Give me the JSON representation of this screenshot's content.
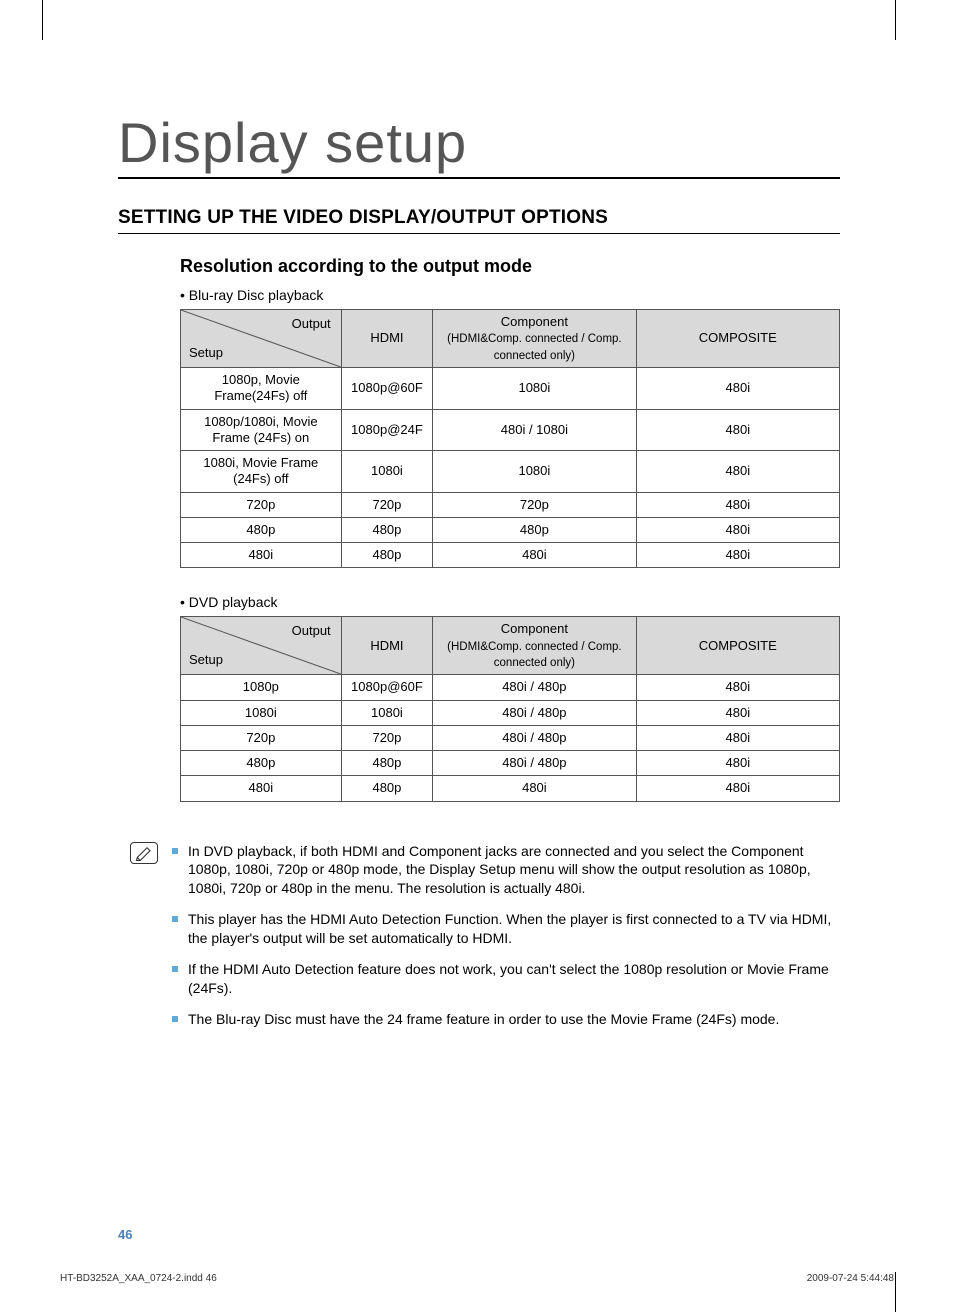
{
  "chapter_title": "Display setup",
  "section_title": "SETTING UP THE VIDEO DISPLAY/OUTPUT OPTIONS",
  "sub_title": "Resolution according to the output mode",
  "table1_caption": "Blu-ray Disc playback",
  "table2_caption": "DVD playback",
  "hdr_output": "Output",
  "hdr_setup": "Setup",
  "col_hdmi": "HDMI",
  "col_component_l1": "Component",
  "col_component_l2": "(HDMI&Comp. connected / Comp. connected only)",
  "col_composite": "COMPOSITE",
  "t1": {
    "rows": [
      {
        "setup": "1080p, Movie Frame(24Fs) off",
        "hdmi": "1080p@60F",
        "comp": "1080i",
        "compos": "480i"
      },
      {
        "setup": "1080p/1080i, Movie Frame (24Fs) on",
        "hdmi": "1080p@24F",
        "comp": "480i / 1080i",
        "compos": "480i"
      },
      {
        "setup": "1080i, Movie Frame (24Fs) off",
        "hdmi": "1080i",
        "comp": "1080i",
        "compos": "480i"
      },
      {
        "setup": "720p",
        "hdmi": "720p",
        "comp": "720p",
        "compos": "480i"
      },
      {
        "setup": "480p",
        "hdmi": "480p",
        "comp": "480p",
        "compos": "480i"
      },
      {
        "setup": "480i",
        "hdmi": "480p",
        "comp": "480i",
        "compos": "480i"
      }
    ]
  },
  "t2": {
    "rows": [
      {
        "setup": "1080p",
        "hdmi": "1080p@60F",
        "comp": "480i / 480p",
        "compos": "480i"
      },
      {
        "setup": "1080i",
        "hdmi": "1080i",
        "comp": "480i / 480p",
        "compos": "480i"
      },
      {
        "setup": "720p",
        "hdmi": "720p",
        "comp": "480i / 480p",
        "compos": "480i"
      },
      {
        "setup": "480p",
        "hdmi": "480p",
        "comp": "480i / 480p",
        "compos": "480i"
      },
      {
        "setup": "480i",
        "hdmi": "480p",
        "comp": "480i",
        "compos": "480i"
      }
    ]
  },
  "notes": [
    "In DVD playback, if both HDMI and Component jacks are connected and you select the Component 1080p, 1080i, 720p or 480p mode, the Display Setup menu will show the output resolution as 1080p, 1080i, 720p or 480p in the menu. The resolution is actually 480i.",
    "This player has the HDMI Auto Detection Function. When the player is first connected to a TV via HDMI, the player's output will be set automatically to HDMI.",
    "If the HDMI Auto Detection feature does not work, you can't select the 1080p resolution or Movie Frame (24Fs).",
    "The Blu-ray Disc must have the 24 frame feature in order to use the Movie Frame (24Fs) mode."
  ],
  "page_number": "46",
  "footer_left": "HT-BD3252A_XAA_0724-2.indd   46",
  "footer_right": "2009-07-24   5:44:48"
}
